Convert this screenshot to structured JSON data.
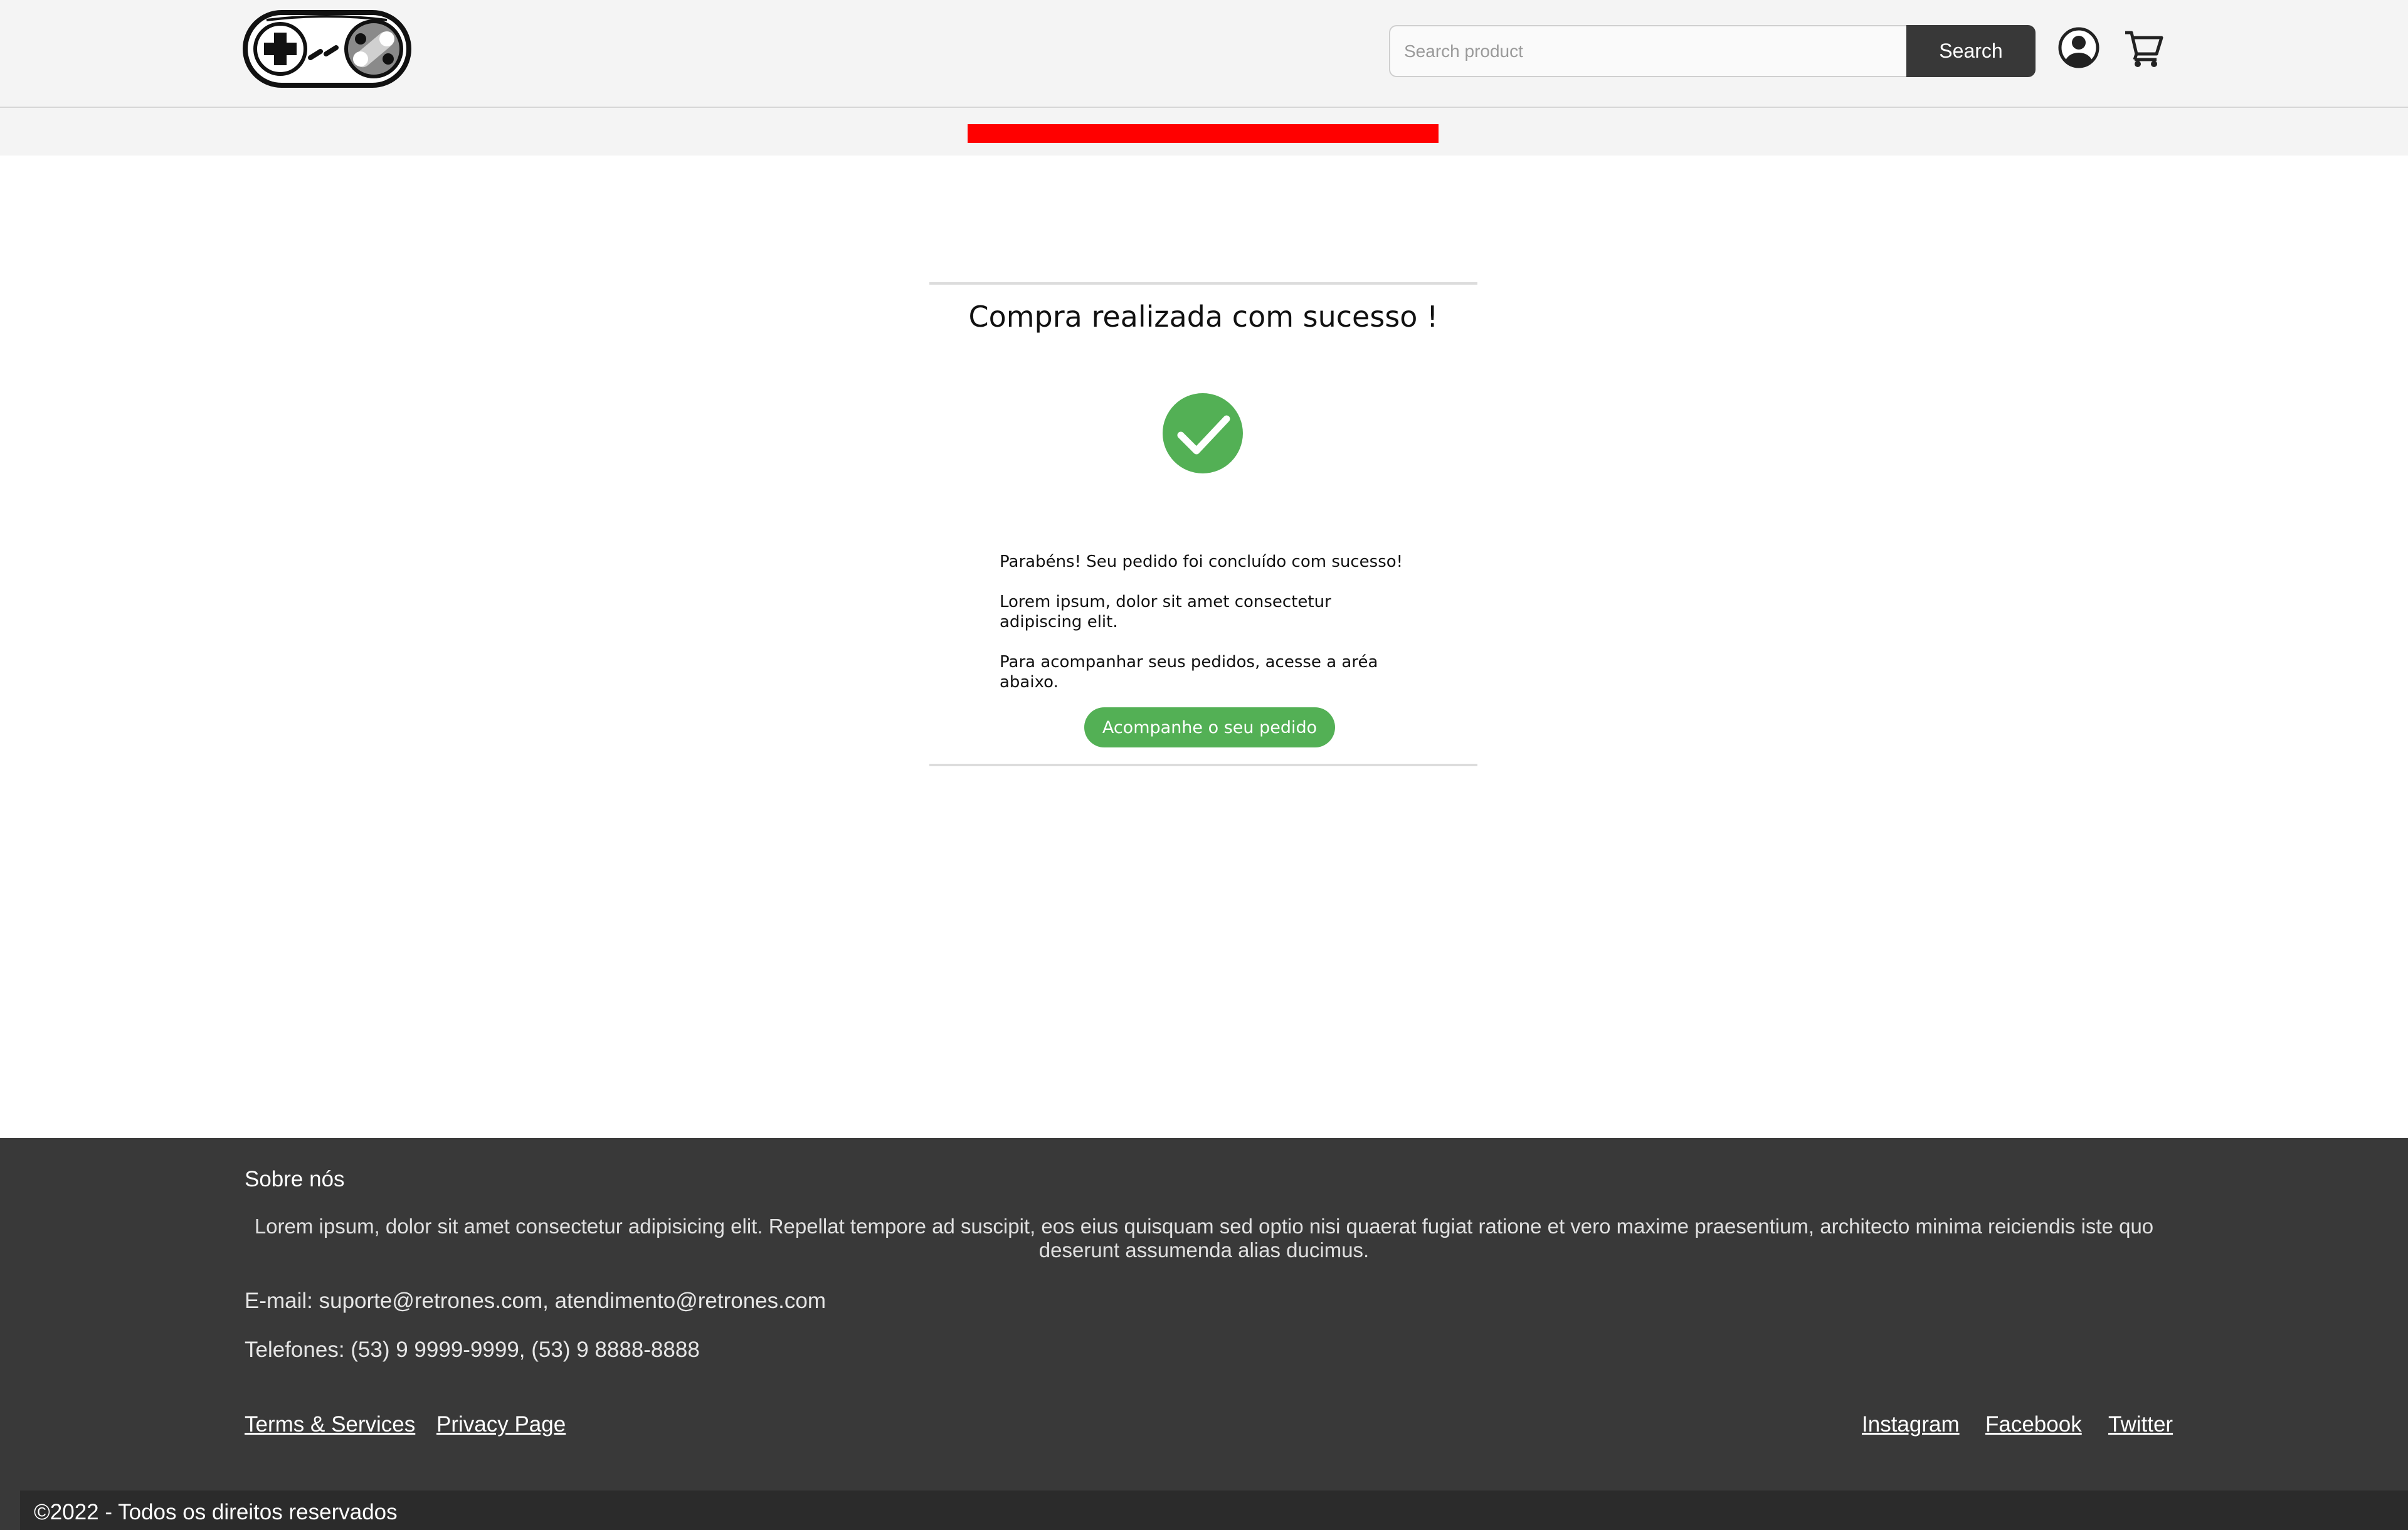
{
  "header": {
    "logo_name": "gamepad-logo",
    "search": {
      "placeholder": "Search product",
      "value": ""
    },
    "search_button_label": "Search",
    "icons": [
      "user-icon",
      "cart-icon"
    ]
  },
  "confirmation": {
    "title": "Compra realizada com sucesso !",
    "status_icon": "check-circle-icon",
    "message_1": "Parabéns! Seu pedido foi concluído com sucesso!",
    "message_2": "Lorem ipsum, dolor sit amet consectetur adipiscing elit.",
    "message_3": "Para acompanhar seus pedidos, acesse a aréa abaixo.",
    "button_label": "Acompanhe o seu pedido"
  },
  "footer": {
    "about_title": "Sobre nós",
    "about_text": "Lorem ipsum, dolor sit amet consectetur adipisicing elit. Repellat tempore ad suscipit, eos eius quisquam sed optio nisi quaerat fugiat ratione et vero maxime praesentium, architecto minima reiciendis iste quo deserunt assumenda alias ducimus.",
    "email": "E-mail: suporte@retrones.com, atendimento@retrones.com",
    "phones": "Telefones: (53) 9 9999-9999, (53) 9 8888-8888",
    "links_left": [
      "Terms & Services",
      "Privacy Page"
    ],
    "links_right": [
      "Instagram",
      "Facebook",
      "Twitter"
    ],
    "copyright": "©2022 - Todos os direitos reservados"
  },
  "colors": {
    "accent_green": "#53b055",
    "promo_bar": "#ff0000",
    "footer_bg": "#393939",
    "header_bg": "#f4f4f4",
    "button_dark": "#383838"
  }
}
